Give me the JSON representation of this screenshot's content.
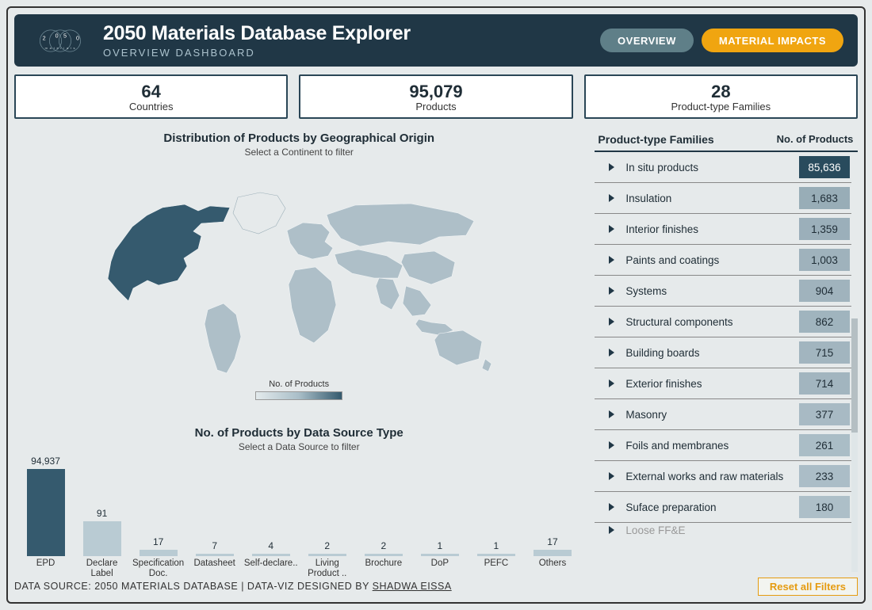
{
  "header": {
    "title": "2050 Materials Database Explorer",
    "subtitle": "OVERVIEW DASHBOARD",
    "tab_overview": "OVERVIEW",
    "tab_impacts": "MATERIAL IMPACTS"
  },
  "kpi": {
    "countries_num": "64",
    "countries_lbl": "Countries",
    "products_num": "95,079",
    "products_lbl": "Products",
    "families_num": "28",
    "families_lbl": "Product-type Families"
  },
  "map": {
    "title": "Distribution of Products by Geographical Origin",
    "subtitle": "Select a Continent to filter",
    "legend_label": "No. of Products"
  },
  "bars": {
    "title": "No. of Products by Data Source Type",
    "subtitle": "Select a Data Source to filter"
  },
  "chart_data": {
    "type": "bar",
    "title": "No. of Products by Data Source Type",
    "xlabel": "",
    "ylabel": "No. of Products",
    "categories": [
      "EPD",
      "Declare Label",
      "Specification Doc.",
      "Datasheet",
      "Self-declare..",
      "Living Product ..",
      "Brochure",
      "DoP",
      "PEFC",
      "Others"
    ],
    "values": [
      94937,
      91,
      17,
      7,
      4,
      2,
      2,
      1,
      1,
      17
    ]
  },
  "table": {
    "head_name": "Product-type Families",
    "head_count": "No. of Products",
    "rows": [
      {
        "name": "In situ products",
        "count": "85,636",
        "countNum": 85636
      },
      {
        "name": "Insulation",
        "count": "1,683",
        "countNum": 1683
      },
      {
        "name": "Interior finishes",
        "count": "1,359",
        "countNum": 1359
      },
      {
        "name": "Paints and coatings",
        "count": "1,003",
        "countNum": 1003
      },
      {
        "name": "Systems",
        "count": "904",
        "countNum": 904
      },
      {
        "name": "Structural components",
        "count": "862",
        "countNum": 862
      },
      {
        "name": "Building boards",
        "count": "715",
        "countNum": 715
      },
      {
        "name": "Exterior finishes",
        "count": "714",
        "countNum": 714
      },
      {
        "name": "Masonry",
        "count": "377",
        "countNum": 377
      },
      {
        "name": "Foils and membranes",
        "count": "261",
        "countNum": 261
      },
      {
        "name": "External works and raw materials",
        "count": "233",
        "countNum": 233
      },
      {
        "name": "Suface preparation",
        "count": "180",
        "countNum": 180
      },
      {
        "name": "Loose FF&E",
        "count": "",
        "countNum": 0
      }
    ]
  },
  "footer": {
    "text_a": "DATA SOURCE: 2050 MATERIALS DATABASE",
    "sep": "   |   ",
    "text_b": "DATA-VIZ DESIGNED BY ",
    "credit": "SHADWA EISSA",
    "reset": "Reset all Filters"
  }
}
